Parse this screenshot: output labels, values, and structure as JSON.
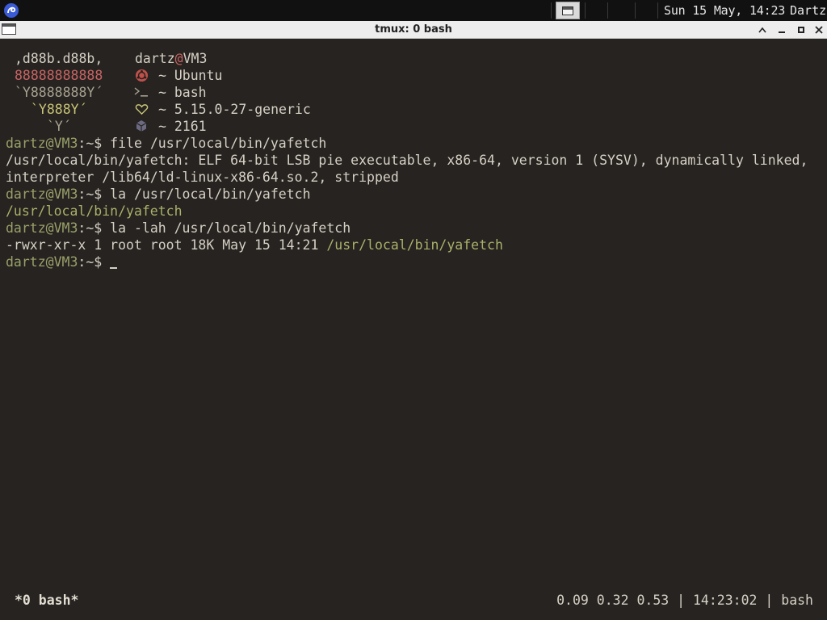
{
  "panel": {
    "clock": "Sun 15 May, 14:23",
    "user": "Dartz"
  },
  "window": {
    "title": "tmux: 0 bash"
  },
  "fetch": {
    "art": [
      ",d88b.d88b,",
      "88888888888",
      "`Y8888888Y´",
      "`Y888Y´",
      "`Y´"
    ],
    "user": "dartz",
    "at": "@",
    "host": "VM3",
    "sep": "~",
    "os": "Ubuntu",
    "shell": "bash",
    "kernel": "5.15.0-27-generic",
    "packages": "2161"
  },
  "prompt": {
    "user_host": "dartz@VM3",
    "suffix": ":~$"
  },
  "session": {
    "cmd1": "file /usr/local/bin/yafetch",
    "out1a": "/usr/local/bin/yafetch: ELF 64-bit LSB pie executable, x86-64, version 1 (SYSV), dynamically linked,",
    "out1b": "interpreter /lib64/ld-linux-x86-64.so.2, stripped",
    "cmd2": "la /usr/local/bin/yafetch",
    "out2": "/usr/local/bin/yafetch",
    "cmd3": "la -lah /usr/local/bin/yafetch",
    "out3_perms": "-rwxr-xr-x 1 root root 18K May 15 14:21 ",
    "out3_path": "/usr/local/bin/yafetch"
  },
  "status": {
    "left": "*0 bash*",
    "right": "0.09 0.32 0.53 | 14:23:02 | bash"
  },
  "colors": {
    "background": "#262320",
    "prompt_green": "#9aa06a",
    "art_red": "#c86464",
    "art_yellow": "#c9c477"
  },
  "icons": {
    "start": "debian-swirl-icon",
    "os": "ubuntu-icon",
    "shell": "terminal-prompt-icon",
    "kernel": "heart-icon",
    "packages": "package-cube-icon"
  }
}
